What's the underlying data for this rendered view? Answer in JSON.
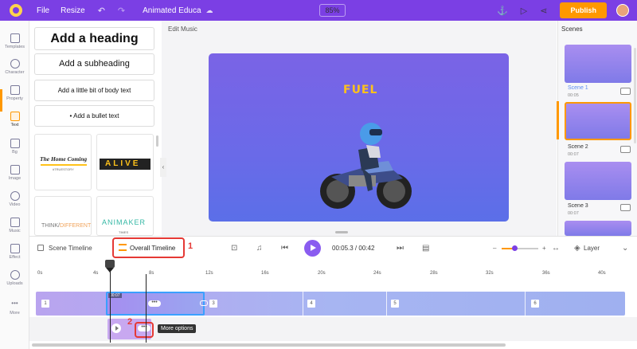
{
  "topbar": {
    "file": "File",
    "resize": "Resize",
    "project_title": "Animated Educa",
    "zoom": "85%",
    "publish": "Publish"
  },
  "rail": [
    {
      "label": "Templates",
      "icon": "templates-icon"
    },
    {
      "label": "Character",
      "icon": "character-icon"
    },
    {
      "label": "Property",
      "icon": "property-icon"
    },
    {
      "label": "Text",
      "icon": "text-icon",
      "active": true
    },
    {
      "label": "Bg",
      "icon": "background-icon"
    },
    {
      "label": "Image",
      "icon": "image-icon"
    },
    {
      "label": "Video",
      "icon": "video-icon"
    },
    {
      "label": "Music",
      "icon": "music-icon"
    },
    {
      "label": "Effect",
      "icon": "effect-icon"
    },
    {
      "label": "Uploads",
      "icon": "uploads-icon"
    },
    {
      "label": "More",
      "icon": "more-icon"
    }
  ],
  "text_panel": {
    "heading": "Add a heading",
    "subheading": "Add a subheading",
    "body": "Add a little bit of body text",
    "bullet": "Add a bullet text",
    "style_cards": [
      {
        "line1": "The Home Coming",
        "line2": "#TRUESTORY"
      },
      {
        "line1": "ALIVE"
      },
      {
        "line1": "THINK/",
        "line1b": "DIFFERENT"
      },
      {
        "line1": "ANIMAKER",
        "line2": "TIMES"
      }
    ]
  },
  "stage": {
    "edit_label": "Edit Music",
    "canvas_text": "FUEL"
  },
  "scenes": {
    "title": "Scenes",
    "items": [
      {
        "name": "Scene 1",
        "duration": "00:05"
      },
      {
        "name": "Scene 2",
        "duration": "00:07"
      },
      {
        "name": "Scene 3",
        "duration": "00:07"
      }
    ]
  },
  "timeline": {
    "scene_timeline": "Scene Timeline",
    "overall_timeline": "Overall Timeline",
    "current_time": "00:05.3",
    "total_time": "00:42",
    "time_sep": " / ",
    "layer": "Layer",
    "annotation_1": "1",
    "annotation_2": "2",
    "ticks": [
      "0s",
      "4s",
      "8s",
      "12s",
      "16s",
      "20s",
      "24s",
      "28s",
      "32s",
      "36s",
      "40s"
    ],
    "segments": [
      "1",
      "3",
      "4",
      "5",
      "6"
    ],
    "selected_duration": "00:07",
    "tooltip": "More options",
    "dots": "•••"
  },
  "colors": {
    "brand": "#7b3fe4",
    "publish": "#ff9800",
    "annotation": "#e53935"
  }
}
